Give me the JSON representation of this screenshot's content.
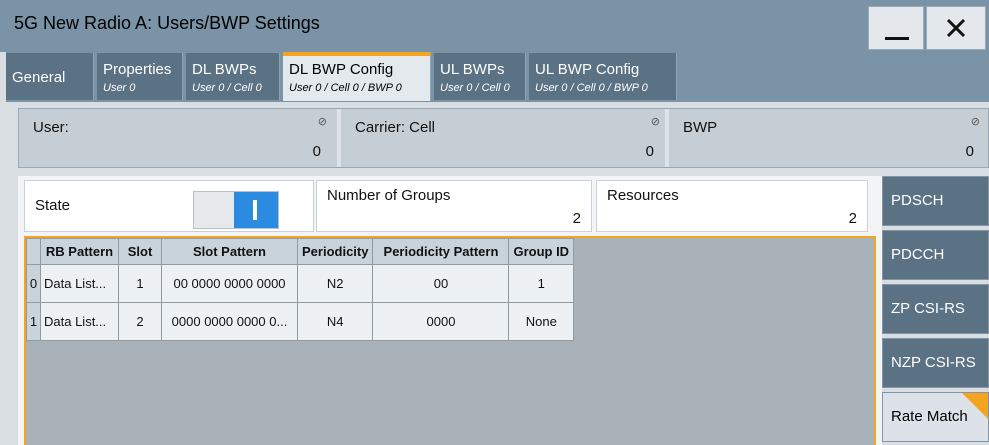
{
  "window": {
    "title": "5G New Radio A: Users/BWP Settings"
  },
  "tabs": [
    {
      "label": "General",
      "sub": ""
    },
    {
      "label": "Properties",
      "sub": "User 0"
    },
    {
      "label": "DL BWPs",
      "sub": "User 0 / Cell 0"
    },
    {
      "label": "DL BWP Config",
      "sub": "User 0 / Cell 0 / BWP 0"
    },
    {
      "label": "UL BWPs",
      "sub": "User 0 / Cell 0"
    },
    {
      "label": "UL BWP Config",
      "sub": "User 0 / Cell 0 / BWP 0"
    }
  ],
  "active_tab": "DL BWP Config",
  "info": {
    "user": {
      "label": "User:",
      "value": "0"
    },
    "carrier": {
      "label": "Carrier: Cell",
      "value": "0"
    },
    "bwp": {
      "label": "BWP",
      "value": "0"
    }
  },
  "settings": {
    "state": {
      "label": "State",
      "on": true
    },
    "groups": {
      "label": "Number of Groups",
      "value": "2"
    },
    "resources": {
      "label": "Resources",
      "value": "2"
    }
  },
  "table": {
    "columns": [
      "RB Pattern",
      "Slot",
      "Slot Pattern",
      "Periodicity",
      "Periodicity Pattern",
      "Group ID"
    ],
    "rows": [
      {
        "idx": "0",
        "cells": [
          "Data List...",
          "1",
          "00 0000 0000 0000",
          "N2",
          "00",
          "1"
        ]
      },
      {
        "idx": "1",
        "cells": [
          "Data List...",
          "2",
          "0000 0000 0000 0...",
          "N4",
          "0000",
          "None"
        ]
      }
    ]
  },
  "sidebar": {
    "items": [
      "PDSCH",
      "PDCCH",
      "ZP CSI-RS",
      "NZP CSI-RS",
      "Rate Match"
    ],
    "active": "Rate Match"
  },
  "colors": {
    "accent": "#f3a421",
    "toggle_on": "#2a8be0",
    "tab_bg": "#5b7184",
    "title_bg": "#7a93a6"
  }
}
